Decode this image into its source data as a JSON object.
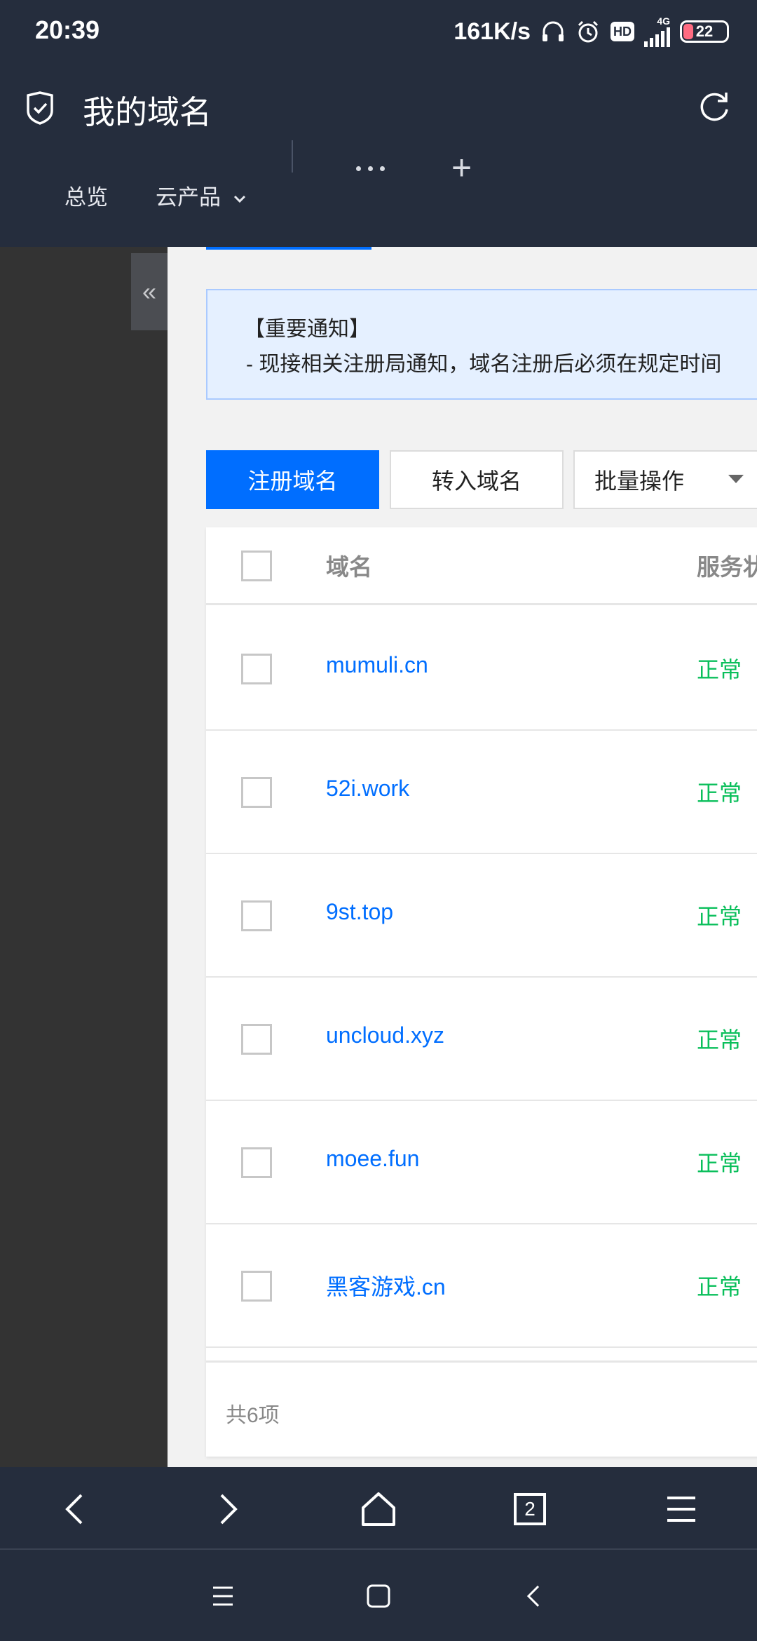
{
  "status_bar": {
    "time": "20:39",
    "net_speed": "161K/s",
    "hd": "HD",
    "network": "4G",
    "battery": "22"
  },
  "header": {
    "title": "我的域名",
    "icons": [
      "shield-check-icon",
      "refresh-icon"
    ]
  },
  "nav": {
    "overview": "总览",
    "cloud_products": "云产品"
  },
  "notice": {
    "title": "【重要通知】",
    "text": "- 现接相关注册局通知，域名注册后必须在规定时间"
  },
  "actions": {
    "register": "注册域名",
    "transfer": "转入域名",
    "batch": "批量操作"
  },
  "table": {
    "columns": [
      "域名",
      "服务状"
    ],
    "rows": [
      {
        "domain": "mumuli.cn",
        "status": "正常"
      },
      {
        "domain": "52i.work",
        "status": "正常"
      },
      {
        "domain": "9st.top",
        "status": "正常"
      },
      {
        "domain": "uncloud.xyz",
        "status": "正常"
      },
      {
        "domain": "moee.fun",
        "status": "正常"
      },
      {
        "domain": "黑客游戏.cn",
        "status": "正常"
      }
    ],
    "total": "共6项"
  },
  "browser": {
    "tab_count": "2"
  },
  "colors": {
    "header_bg": "#252d3d",
    "primary": "#006eff",
    "success": "#0abf5b",
    "notice_bg": "#e5f0ff"
  }
}
